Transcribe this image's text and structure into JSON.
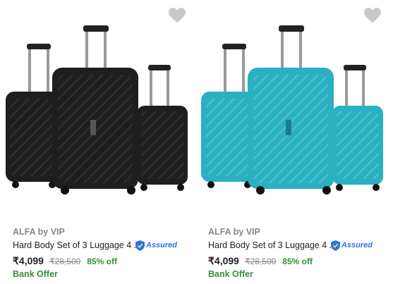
{
  "products": [
    {
      "brand": "ALFA by VIP",
      "title": "Hard Body Set of 3 Luggage 4 ...",
      "assured": "Assured",
      "price": "₹4,099",
      "mrp": "₹28,500",
      "discount": "85% off",
      "offer": "Bank Offer",
      "color": "#1e1e1e",
      "icon": "heart-icon"
    },
    {
      "brand": "ALFA by VIP",
      "title": "Hard Body Set of 3 Luggage 4 ...",
      "assured": "Assured",
      "price": "₹4,099",
      "mrp": "₹28,500",
      "discount": "85% off",
      "offer": "Bank Offer",
      "color": "#2ab0c0",
      "icon": "heart-icon"
    }
  ]
}
